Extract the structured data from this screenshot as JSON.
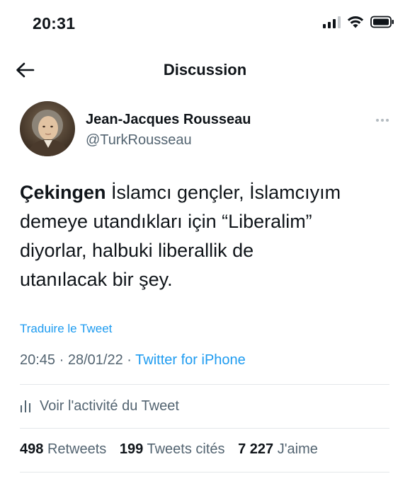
{
  "status_bar": {
    "time": "20:31",
    "icons": [
      "signal-icon",
      "wifi-icon",
      "battery-icon"
    ]
  },
  "header": {
    "back_icon": "arrow-left-icon",
    "title": "Discussion"
  },
  "tweet": {
    "author": {
      "name": "Jean-Jacques Rousseau",
      "handle": "@TurkRousseau"
    },
    "more_icon": "more-horizontal-icon",
    "text_lines": [
      {
        "emphasis": "Çekingen",
        "rest": " İslamcı gençler, İslamcıyım"
      },
      {
        "text": "demeye utandıkları için “Liberalim”"
      },
      {
        "text": "diyorlar, halbuki liberallik de"
      },
      {
        "text": "utanılacak bir şey."
      }
    ],
    "translate_label": "Traduire le Tweet",
    "time": "20:45",
    "date": "28/01/22",
    "separator": "·",
    "source": "Twitter for iPhone",
    "activity_icon": "analytics-bars-icon",
    "activity_label": "Voir l'activité du Tweet",
    "stats": {
      "retweets_count": "498",
      "retweets_label": "Retweets",
      "quotes_count": "199",
      "quotes_label": "Tweets cités",
      "likes_count": "7 227",
      "likes_label": "J'aime"
    }
  },
  "colors": {
    "text": "#0f1419",
    "secondary": "#536471",
    "link": "#1d9bf0",
    "divider": "#e3e7ea"
  }
}
